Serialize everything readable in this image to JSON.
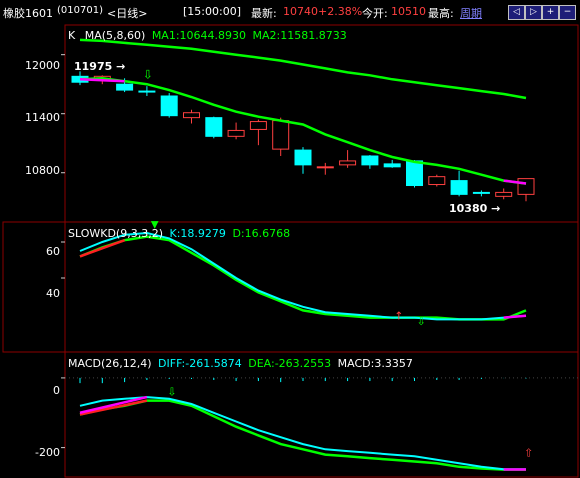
{
  "header": {
    "symbol": "橡胶1601",
    "code": "(010701)",
    "period": "<日线>",
    "time": "[15:00:00]",
    "latest_label": "最新:",
    "latest_value": "10740",
    "change": "+2.38%",
    "open_label": "今开:",
    "open_value": "10510",
    "high_label": "最高:",
    "high_value": "周期",
    "buttons": [
      "◁",
      "▷",
      "+",
      "−"
    ]
  },
  "panels": {
    "price": {
      "k_label": "K",
      "ma_label": "MA(5,8,60)",
      "ma1_label": "MA1:10644.8930",
      "ma2_label": "MA2:11581.8733",
      "y_ticks": [
        "12000",
        "11400",
        "10800"
      ],
      "max_label": "11975",
      "min_label": "10380"
    },
    "kd": {
      "name": "SLOWKD(9,3,3,2)",
      "k_label": "K:18.9279",
      "d_label": "D:16.6768",
      "y_ticks": [
        "60",
        "40"
      ]
    },
    "macd": {
      "name": "MACD(26,12,4)",
      "diff_label": "DIFF:-261.5874",
      "dea_label": "DEA:-263.2553",
      "macd_label": "MACD:3.3357",
      "y_ticks": [
        "0",
        "-200"
      ]
    }
  },
  "colors": {
    "up_candle": "#ff4040",
    "down_candle": "#00ffff",
    "ma1": "#00ff00",
    "ma2": "#00ff00",
    "grid": "#8b0000",
    "kd_k": "#00ffff",
    "kd_d": "#00ff00",
    "macd_diff": "#00ffff",
    "macd_dea": "#00ff00",
    "macd_bar": "#00ffff",
    "accent": "#ff00ff"
  },
  "chart_data": [
    {
      "type": "line",
      "title": "K MA(5,8,60)",
      "series": [
        {
          "name": "K",
          "candles": [
            {
              "open": 11780,
              "close": 11720,
              "high": 11830,
              "low": 11690
            },
            {
              "open": 11740,
              "close": 11780,
              "high": 11790,
              "low": 11700
            },
            {
              "open": 11700,
              "close": 11640,
              "high": 11760,
              "low": 11620
            },
            {
              "open": 11630,
              "close": 11620,
              "high": 11680,
              "low": 11580
            },
            {
              "open": 11580,
              "close": 11380,
              "high": 11610,
              "low": 11360
            },
            {
              "open": 11360,
              "close": 11410,
              "high": 11440,
              "low": 11300
            },
            {
              "open": 11360,
              "close": 11170,
              "high": 11370,
              "low": 11150
            },
            {
              "open": 11170,
              "close": 11230,
              "high": 11310,
              "low": 11140
            },
            {
              "open": 11240,
              "close": 11320,
              "high": 11340,
              "low": 11080
            },
            {
              "open": 11040,
              "close": 11330,
              "high": 11360,
              "low": 10970
            },
            {
              "open": 11030,
              "close": 10880,
              "high": 11060,
              "low": 10790
            },
            {
              "open": 10850,
              "close": 10860,
              "high": 10900,
              "low": 10780
            },
            {
              "open": 10880,
              "close": 10920,
              "high": 11030,
              "low": 10850
            },
            {
              "open": 10970,
              "close": 10880,
              "high": 10980,
              "low": 10840
            },
            {
              "open": 10890,
              "close": 10860,
              "high": 10930,
              "low": 10850
            },
            {
              "open": 10920,
              "close": 10670,
              "high": 10930,
              "low": 10650
            },
            {
              "open": 10680,
              "close": 10760,
              "high": 10780,
              "low": 10660
            },
            {
              "open": 10720,
              "close": 10580,
              "high": 10820,
              "low": 10560
            },
            {
              "open": 10600,
              "close": 10590,
              "high": 10620,
              "low": 10560
            },
            {
              "open": 10560,
              "close": 10600,
              "high": 10640,
              "low": 10530
            },
            {
              "open": 10580,
              "close": 10740,
              "high": 10740,
              "low": 10510
            }
          ]
        },
        {
          "name": "MA1",
          "values": [
            11750,
            11760,
            11730,
            11700,
            11640,
            11570,
            11490,
            11420,
            11370,
            11330,
            11290,
            11190,
            11110,
            11030,
            10960,
            10910,
            10880,
            10840,
            10780,
            10720,
            10690
          ]
        },
        {
          "name": "MA2",
          "values": [
            12150,
            12140,
            12120,
            12100,
            12080,
            12060,
            12030,
            12000,
            11970,
            11940,
            11900,
            11860,
            11820,
            11790,
            11750,
            11720,
            11690,
            11660,
            11630,
            11600,
            11560
          ]
        }
      ],
      "y_ticks": [
        12000,
        11400,
        10800
      ],
      "ylim": [
        10350,
        12200
      ]
    },
    {
      "type": "line",
      "title": "SLOWKD(9,3,3,2)",
      "series": [
        {
          "name": "K",
          "values": [
            55,
            60,
            64,
            65,
            62,
            56,
            48,
            40,
            33,
            28,
            24,
            21,
            20,
            19,
            18,
            18,
            17,
            17,
            17,
            18,
            19
          ]
        },
        {
          "name": "D",
          "values": [
            52,
            57,
            61,
            63,
            61,
            54,
            47,
            39,
            32,
            27,
            22,
            20,
            19,
            18,
            18,
            18,
            18,
            17,
            17,
            17,
            22
          ]
        }
      ],
      "y_ticks": [
        60,
        40
      ],
      "ylim": [
        0,
        70
      ]
    },
    {
      "type": "line",
      "title": "MACD(26,12,4)",
      "series": [
        {
          "name": "DIFF",
          "values": [
            -80,
            -65,
            -60,
            -55,
            -60,
            -75,
            -100,
            -125,
            -150,
            -170,
            -190,
            -205,
            -210,
            -215,
            -220,
            -225,
            -235,
            -245,
            -255,
            -262,
            -262
          ]
        },
        {
          "name": "DEA",
          "values": [
            -105,
            -90,
            -80,
            -65,
            -65,
            -80,
            -110,
            -140,
            -165,
            -190,
            -205,
            -220,
            -225,
            -230,
            -235,
            -240,
            -245,
            -255,
            -260,
            -263,
            -263
          ]
        },
        {
          "name": "MACD",
          "values": [
            25,
            25,
            20,
            10,
            5,
            5,
            10,
            15,
            15,
            20,
            15,
            15,
            15,
            15,
            15,
            15,
            10,
            10,
            5,
            1,
            3
          ]
        }
      ],
      "y_ticks": [
        0,
        -200
      ],
      "ylim": [
        -270,
        60
      ]
    }
  ]
}
